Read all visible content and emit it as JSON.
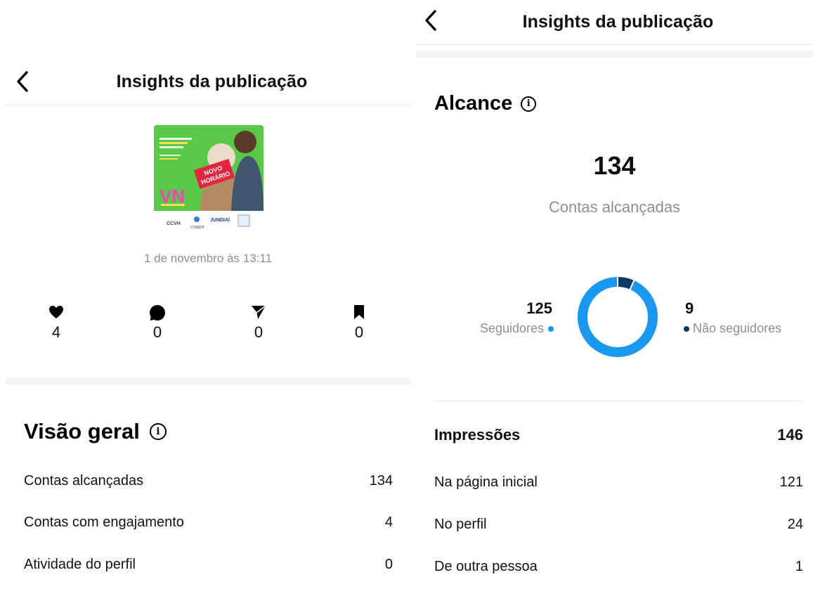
{
  "left": {
    "header": {
      "title": "Insights da publicação"
    },
    "post": {
      "thumbnail_text": {
        "headline": "Caminhada no CCVH e Vale Novo para a pessoa idosa",
        "badge_line1": "NOVO",
        "badge_line2": "HORÁRIO",
        "logo": "VN",
        "sponsor1": "CCVH",
        "sponsor2": "COMDIP",
        "sponsor3": "JUNDIAÍ"
      },
      "date": "1 de novembro às 13:11"
    },
    "stats": [
      {
        "icon": "heart-icon",
        "value": "4"
      },
      {
        "icon": "comment-icon",
        "value": "0"
      },
      {
        "icon": "send-icon",
        "value": "0"
      },
      {
        "icon": "bookmark-icon",
        "value": "0"
      }
    ],
    "overview": {
      "title": "Visão geral",
      "info_glyph": "i",
      "rows": [
        {
          "label": "Contas alcançadas",
          "value": "134"
        },
        {
          "label": "Contas com engajamento",
          "value": "4"
        },
        {
          "label": "Atividade do perfil",
          "value": "0"
        }
      ]
    }
  },
  "right": {
    "header": {
      "title": "Insights da publicação"
    },
    "reach": {
      "title": "Alcance",
      "info_glyph": "i",
      "total": "134",
      "total_label": "Contas alcançadas",
      "followers": {
        "value": "125",
        "label": "Seguidores",
        "color": "#1a98f0"
      },
      "non_followers": {
        "value": "9",
        "label": "Não seguidores",
        "color": "#0d3a63"
      }
    },
    "impressions": {
      "title": "Impressões",
      "total": "146",
      "rows": [
        {
          "label": "Na página inicial",
          "value": "121"
        },
        {
          "label": "No perfil",
          "value": "24"
        },
        {
          "label": "De outra pessoa",
          "value": "1"
        }
      ]
    }
  },
  "colors": {
    "followers": "#1a98f0",
    "non_followers": "#0d3a63",
    "thumb_green": "#5cc84a"
  }
}
